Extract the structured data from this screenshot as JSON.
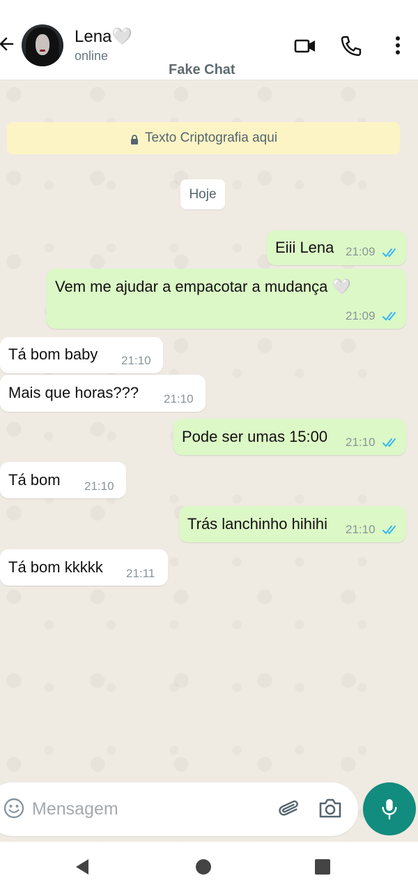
{
  "header": {
    "contact_name": "Lena",
    "contact_emoji": "🤍",
    "status": "online",
    "subtitle": "Fake Chat",
    "icons": [
      "back-arrow-icon",
      "video-call-icon",
      "phone-icon",
      "more-vertical-icon"
    ]
  },
  "chat": {
    "encryption_notice": "Texto Criptografia aqui",
    "day_label": "Hoje",
    "messages": [
      {
        "direction": "out",
        "text": "Eiii Lena",
        "time": "21:09",
        "read": true
      },
      {
        "direction": "out",
        "text": "Vem me ajudar a empacotar a mudança 🤍",
        "time": "21:09",
        "read": true
      },
      {
        "direction": "in",
        "text": "Tá bom baby",
        "time": "21:10"
      },
      {
        "direction": "in",
        "text": "Mais que horas???",
        "time": "21:10"
      },
      {
        "direction": "out",
        "text": "Pode ser umas 15:00",
        "time": "21:10",
        "read": true
      },
      {
        "direction": "in",
        "text": "Tá bom",
        "time": "21:10"
      },
      {
        "direction": "out",
        "text": "Trás lanchinho hihihi",
        "time": "21:10",
        "read": true
      },
      {
        "direction": "in",
        "text": "Tá bom kkkkk",
        "time": "21:11"
      }
    ]
  },
  "composer": {
    "placeholder": "Mensagem",
    "icons": [
      "emoji-icon",
      "attach-icon",
      "camera-icon",
      "mic-icon"
    ]
  },
  "colors": {
    "outgoing_bubble": "#dcf8c6",
    "incoming_bubble": "#ffffff",
    "chat_background": "#efeae2",
    "accent": "#128c7e",
    "read_ticks": "#34b7f1"
  }
}
